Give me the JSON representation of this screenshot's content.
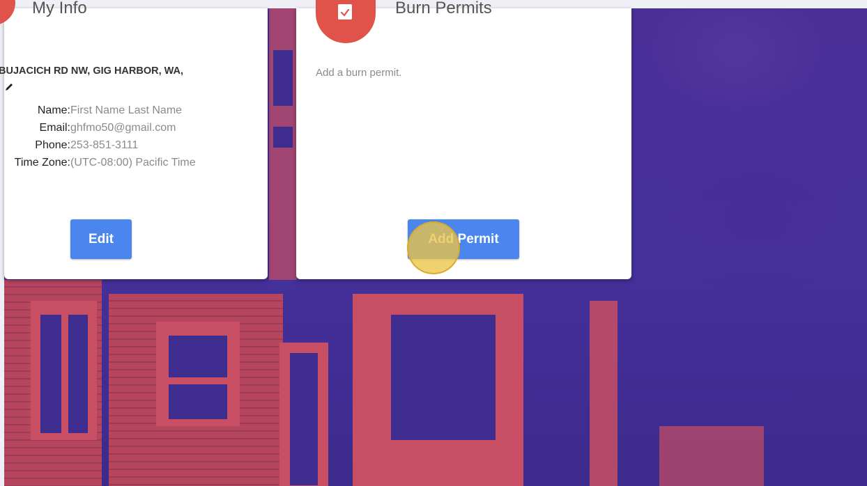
{
  "my_info_card": {
    "title": "My Info",
    "address": "BUJACICH RD NW, GIG HARBOR, WA,",
    "edit_icon": "pencil-icon",
    "rows": [
      {
        "label": "Name:",
        "value": "First Name Last Name"
      },
      {
        "label": "Email:",
        "value": "ghfmo50@gmail.com"
      },
      {
        "label": "Phone:",
        "value": "253-851-3111"
      },
      {
        "label": "Time Zone:",
        "value": "(UTC-08:00) Pacific Time"
      }
    ],
    "edit_button": "Edit"
  },
  "burn_permits_card": {
    "icon": "clipboard-check-icon",
    "title": "Burn Permits",
    "description": "Add a burn permit.",
    "add_button": "Add Permit"
  },
  "colors": {
    "accent_red": "#e0534a",
    "button_blue": "#4a86ee",
    "cursor_highlight": "#ecc446"
  }
}
